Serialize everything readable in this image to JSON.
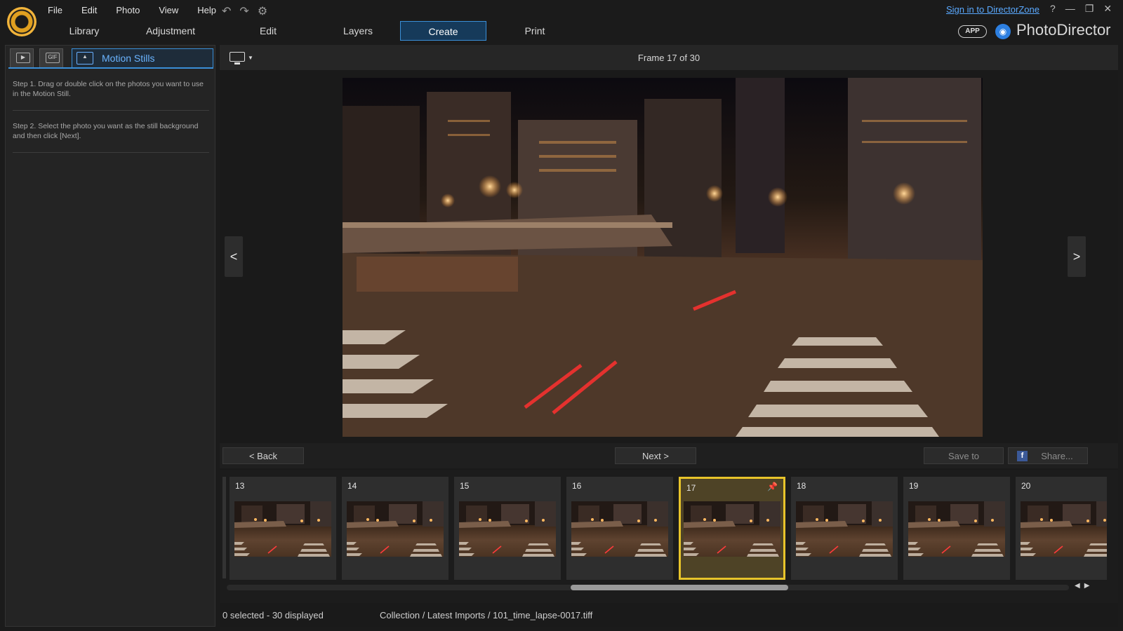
{
  "menu": [
    "File",
    "Edit",
    "Photo",
    "View",
    "Help"
  ],
  "modes": [
    "Library",
    "Adjustment",
    "Edit",
    "Layers",
    "Create",
    "Print"
  ],
  "active_mode": "Create",
  "signin": "Sign in to DirectorZone",
  "app_badge": "APP",
  "brand": "PhotoDirector",
  "left_panel": {
    "tab_label": "Motion Stills",
    "gif_tab_label": "GIF",
    "step1": "Step 1. Drag or double click on the photos you want to use in the Motion Still.",
    "step2": "Step 2. Select the photo you want as the still background and then click [Next]."
  },
  "viewer": {
    "frame_label": "Frame  17 of  30",
    "prev": "<",
    "next": ">"
  },
  "actions": {
    "back": "<  Back",
    "next": "Next  >",
    "save_to": "Save to",
    "share": "Share..."
  },
  "filmstrip": {
    "frames": [
      "13",
      "14",
      "15",
      "16",
      "17",
      "18",
      "19",
      "20"
    ],
    "selected": "17"
  },
  "status": {
    "count": "0 selected - 30 displayed",
    "path": "Collection / Latest Imports / 101_time_lapse-0017.tiff"
  },
  "colors": {
    "accent": "#3a8fd8",
    "selection": "#e8c42a",
    "arrow": "#e21d1d"
  }
}
